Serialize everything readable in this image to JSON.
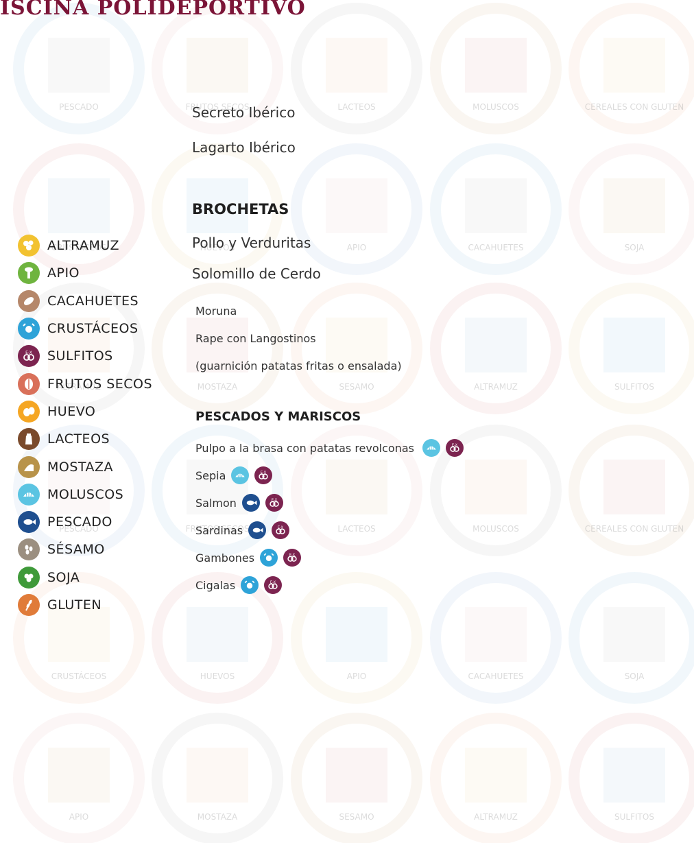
{
  "header": {
    "title": "ISCINA POLIDEPORTIVO"
  },
  "watermark_labels": [
    "PESCADO",
    "FRUTOS SECOS",
    "LACTEOS",
    "MOLUSCOS",
    "CEREALES CON GLUTEN",
    "CRUSTÁCEOS",
    "HUEVOS",
    "APIO",
    "CACAHUETES",
    "SOJA",
    "ALTRAMUZ",
    "MOSTAZA",
    "SESAMO",
    "ALTRAMUZ",
    "SULFITOS",
    "PESCADO",
    "FRUTOS SECOS",
    "LACTEOS",
    "MOLUSCOS",
    "CEREALES CON GLUTEN",
    "CRUSTÁCEOS",
    "HUEVOS",
    "APIO",
    "CACAHUETES",
    "SOJA",
    "APIO",
    "MOSTAZA",
    "SESAMO",
    "ALTRAMUZ",
    "SULFITOS"
  ],
  "menu": {
    "top_items": [
      "Secreto Ibérico",
      "Lagarto Ibérico"
    ],
    "brochetas": {
      "title": "BROCHETAS",
      "items": [
        "Pollo y Verduritas",
        "Solomillo de Cerdo"
      ],
      "sub_items": [
        "Moruna",
        "Rape con Langostinos",
        "(guarnición patatas fritas o ensalada)"
      ]
    },
    "pescados": {
      "title": "PESCADOS Y MARISCOS",
      "items": [
        {
          "name": "Pulpo a la brasa con patatas revolconas",
          "allergens": [
            "moluscos",
            "sulfitos"
          ]
        },
        {
          "name": "Sepia",
          "allergens": [
            "moluscos",
            "sulfitos"
          ]
        },
        {
          "name": "Salmon",
          "allergens": [
            "pescado",
            "sulfitos"
          ]
        },
        {
          "name": "Sardinas",
          "allergens": [
            "pescado",
            "sulfitos"
          ]
        },
        {
          "name": "Gambones",
          "allergens": [
            "crustaceos",
            "sulfitos"
          ]
        },
        {
          "name": "Cigalas",
          "allergens": [
            "crustaceos",
            "sulfitos"
          ]
        }
      ]
    }
  },
  "legend": [
    {
      "key": "altramuz",
      "label": "ALTRAMUZ",
      "color": "#f2c230",
      "icon": "lupin-icon"
    },
    {
      "key": "apio",
      "label": "APIO",
      "color": "#6fb43f",
      "icon": "celery-icon"
    },
    {
      "key": "cacahuetes",
      "label": "CACAHUETES",
      "color": "#b5876a",
      "icon": "peanut-icon"
    },
    {
      "key": "crustaceos",
      "label": "CRUSTÁCEOS",
      "color": "#2ea3d8",
      "icon": "crab-icon"
    },
    {
      "key": "sulfitos",
      "label": "SULFITOS",
      "color": "#7c2450",
      "icon": "sulfites-icon"
    },
    {
      "key": "frutos_secos",
      "label": "FRUTOS SECOS",
      "color": "#d9705a",
      "icon": "nut-icon"
    },
    {
      "key": "huevo",
      "label": "HUEVO",
      "color": "#f5a623",
      "icon": "egg-icon"
    },
    {
      "key": "lacteos",
      "label": "LACTEOS",
      "color": "#7a4a2b",
      "icon": "milk-icon"
    },
    {
      "key": "mostaza",
      "label": "MOSTAZA",
      "color": "#b8934a",
      "icon": "mustard-icon"
    },
    {
      "key": "moluscos",
      "label": "MOLUSCOS",
      "color": "#5bc4e2",
      "icon": "shell-icon"
    },
    {
      "key": "pescado",
      "label": "PESCADO",
      "color": "#1f4f8f",
      "icon": "fish-icon"
    },
    {
      "key": "sesamo",
      "label": "SÉSAMO",
      "color": "#9b8f80",
      "icon": "sesame-icon"
    },
    {
      "key": "soja",
      "label": "SOJA",
      "color": "#3f9a3a",
      "icon": "soy-icon"
    },
    {
      "key": "gluten",
      "label": "GLUTEN",
      "color": "#e07b39",
      "icon": "wheat-icon"
    }
  ]
}
